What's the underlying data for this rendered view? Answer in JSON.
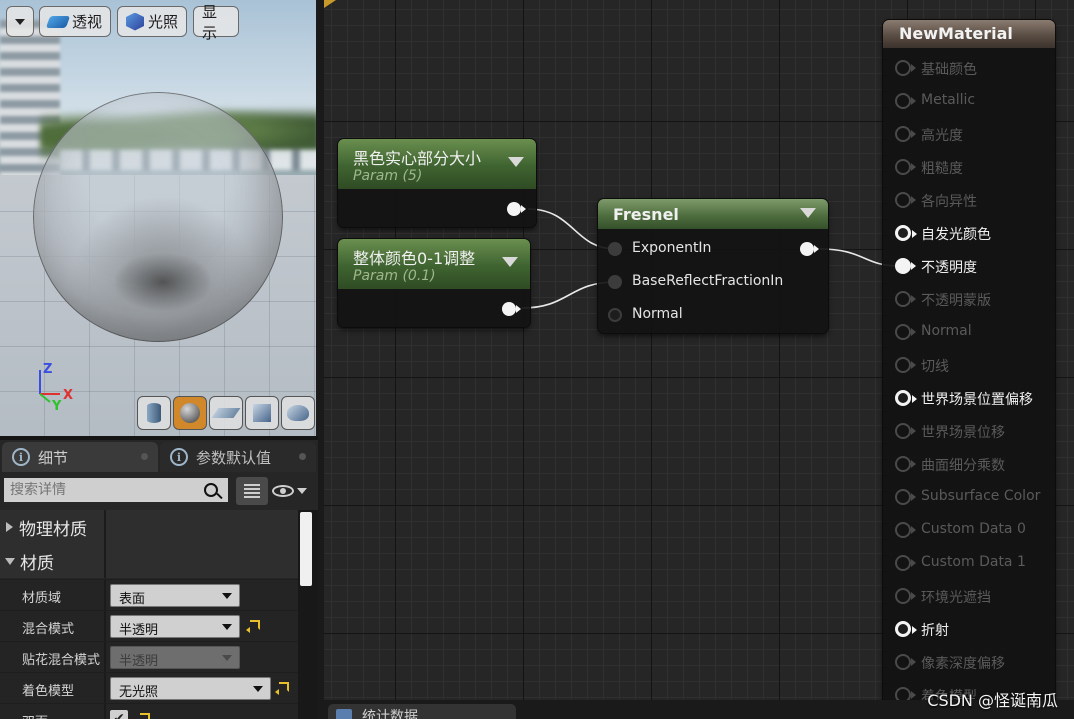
{
  "viewport": {
    "menu_label": "",
    "perspective_label": "透视",
    "lighting_label": "光照",
    "show_label": "显示",
    "axes": {
      "z": "Z",
      "x": "X",
      "y": "Y"
    },
    "preview_shapes": [
      "cylinder-icon",
      "sphere-icon",
      "plane-icon",
      "cube-icon",
      "teapot-icon"
    ],
    "active_preview": "sphere-icon"
  },
  "details": {
    "tabs": [
      {
        "label": "细节",
        "icon": "info-icon"
      },
      {
        "label": "参数默认值",
        "icon": "info-icon"
      }
    ],
    "search": {
      "placeholder": "搜索详情"
    },
    "categories": {
      "physical": "物理材质",
      "material": "材质"
    },
    "properties": [
      {
        "label": "材质域",
        "value": "表面"
      },
      {
        "label": "混合模式",
        "value": "半透明"
      },
      {
        "label": "贴花混合模式",
        "value": "半透明"
      },
      {
        "label": "着色模型",
        "value": "无光照"
      },
      {
        "label": "双面",
        "value": "✔"
      }
    ]
  },
  "graph": {
    "nodes": {
      "param1": {
        "title": "黑色实心部分大小",
        "subtitle": "Param (5)"
      },
      "param2": {
        "title": "整体颜色0-1调整",
        "subtitle": "Param (0.1)"
      },
      "fresnel": {
        "title": "Fresnel",
        "inputs": [
          "ExponentIn",
          "BaseReflectFractionIn",
          "Normal"
        ]
      },
      "material": {
        "title": "NewMaterial",
        "inputs": [
          {
            "label": "基础颜色",
            "enabled": false
          },
          {
            "label": "Metallic",
            "enabled": false
          },
          {
            "label": "高光度",
            "enabled": false
          },
          {
            "label": "粗糙度",
            "enabled": false
          },
          {
            "label": "各向异性",
            "enabled": false
          },
          {
            "label": "自发光颜色",
            "enabled": true
          },
          {
            "label": "不透明度",
            "enabled": true
          },
          {
            "label": "不透明蒙版",
            "enabled": false
          },
          {
            "label": "Normal",
            "enabled": false
          },
          {
            "label": "切线",
            "enabled": false
          },
          {
            "label": "世界场景位置偏移",
            "enabled": true
          },
          {
            "label": "世界场景位移",
            "enabled": false
          },
          {
            "label": "曲面细分乘数",
            "enabled": false
          },
          {
            "label": "Subsurface Color",
            "enabled": false
          },
          {
            "label": "Custom Data 0",
            "enabled": false
          },
          {
            "label": "Custom Data 1",
            "enabled": false
          },
          {
            "label": "环境光遮挡",
            "enabled": false
          },
          {
            "label": "折射",
            "enabled": true
          },
          {
            "label": "像素深度偏移",
            "enabled": false
          },
          {
            "label": "着色模型",
            "enabled": false
          }
        ]
      }
    }
  },
  "bottom": {
    "stats_tab": "统计数据",
    "watermark": "CSDN @怪诞南瓜"
  },
  "colors": {
    "param_header": "#3f6330",
    "material_header": "#5a4d44",
    "active_preview": "#d1882a",
    "reset_arrow": "#e8c12a"
  }
}
